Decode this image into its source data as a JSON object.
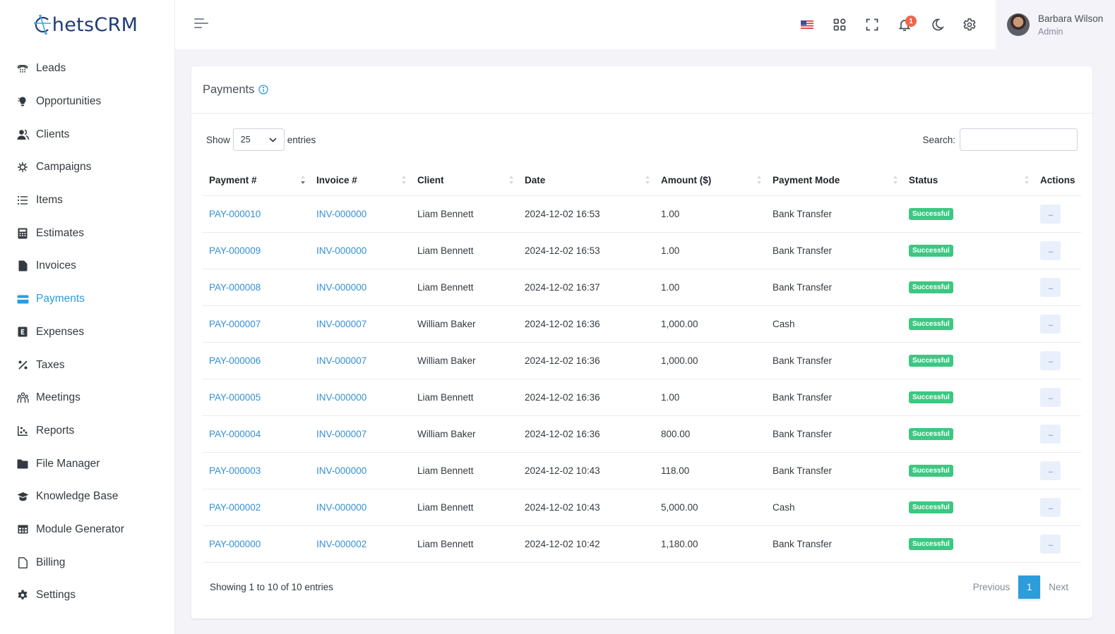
{
  "brand": {
    "name": "hetsCRM",
    "logo_letter": "C"
  },
  "sidebar": {
    "items": [
      {
        "label": "Leads",
        "icon": "phone-icon"
      },
      {
        "label": "Opportunities",
        "icon": "lightbulb-icon"
      },
      {
        "label": "Clients",
        "icon": "users-icon"
      },
      {
        "label": "Campaigns",
        "icon": "virus-icon"
      },
      {
        "label": "Items",
        "icon": "list-icon"
      },
      {
        "label": "Estimates",
        "icon": "calculator-icon"
      },
      {
        "label": "Invoices",
        "icon": "file-icon"
      },
      {
        "label": "Payments",
        "icon": "credit-card-icon",
        "active": true
      },
      {
        "label": "Expenses",
        "icon": "expense-icon"
      },
      {
        "label": "Taxes",
        "icon": "percent-icon"
      },
      {
        "label": "Meetings",
        "icon": "people-group-icon"
      },
      {
        "label": "Reports",
        "icon": "chart-scatter-icon"
      },
      {
        "label": "File Manager",
        "icon": "folder-icon"
      },
      {
        "label": "Knowledge Base",
        "icon": "graduation-cap-icon"
      },
      {
        "label": "Module Generator",
        "icon": "table-icon"
      },
      {
        "label": "Billing",
        "icon": "file-outline-icon"
      },
      {
        "label": "Settings",
        "icon": "gear-icon"
      }
    ]
  },
  "topbar": {
    "notification_count": "1",
    "user": {
      "name": "Barbara Wilson",
      "role": "Admin"
    }
  },
  "page": {
    "title": "Payments",
    "show_label": "Show",
    "entries_label": "entries",
    "page_length": "25",
    "search_label": "Search:",
    "search_value": "",
    "columns": [
      "Payment #",
      "Invoice #",
      "Client",
      "Date",
      "Amount ($)",
      "Payment Mode",
      "Status",
      "Actions"
    ],
    "rows": [
      {
        "payment": "PAY-000010",
        "invoice": "INV-000000",
        "client": "Liam Bennett",
        "date": "2024-12-02 16:53",
        "amount": "1.00",
        "mode": "Bank Transfer",
        "status": "Successful",
        "action": "..."
      },
      {
        "payment": "PAY-000009",
        "invoice": "INV-000000",
        "client": "Liam Bennett",
        "date": "2024-12-02 16:53",
        "amount": "1.00",
        "mode": "Bank Transfer",
        "status": "Successful",
        "action": "..."
      },
      {
        "payment": "PAY-000008",
        "invoice": "INV-000000",
        "client": "Liam Bennett",
        "date": "2024-12-02 16:37",
        "amount": "1.00",
        "mode": "Bank Transfer",
        "status": "Successful",
        "action": "..."
      },
      {
        "payment": "PAY-000007",
        "invoice": "INV-000007",
        "client": "William Baker",
        "date": "2024-12-02 16:36",
        "amount": "1,000.00",
        "mode": "Cash",
        "status": "Successful",
        "action": "..."
      },
      {
        "payment": "PAY-000006",
        "invoice": "INV-000007",
        "client": "William Baker",
        "date": "2024-12-02 16:36",
        "amount": "1,000.00",
        "mode": "Bank Transfer",
        "status": "Successful",
        "action": "..."
      },
      {
        "payment": "PAY-000005",
        "invoice": "INV-000000",
        "client": "Liam Bennett",
        "date": "2024-12-02 16:36",
        "amount": "1.00",
        "mode": "Bank Transfer",
        "status": "Successful",
        "action": "..."
      },
      {
        "payment": "PAY-000004",
        "invoice": "INV-000007",
        "client": "William Baker",
        "date": "2024-12-02 16:36",
        "amount": "800.00",
        "mode": "Bank Transfer",
        "status": "Successful",
        "action": "..."
      },
      {
        "payment": "PAY-000003",
        "invoice": "INV-000000",
        "client": "Liam Bennett",
        "date": "2024-12-02 10:43",
        "amount": "118.00",
        "mode": "Bank Transfer",
        "status": "Successful",
        "action": "..."
      },
      {
        "payment": "PAY-000002",
        "invoice": "INV-000000",
        "client": "Liam Bennett",
        "date": "2024-12-02 10:43",
        "amount": "5,000.00",
        "mode": "Cash",
        "status": "Successful",
        "action": "..."
      },
      {
        "payment": "PAY-000000",
        "invoice": "INV-000002",
        "client": "Liam Bennett",
        "date": "2024-12-02 10:42",
        "amount": "1,180.00",
        "mode": "Bank Transfer",
        "status": "Successful",
        "action": "..."
      }
    ],
    "showing_text": "Showing 1 to 10 of 10 entries",
    "pagination": {
      "previous": "Previous",
      "current": "1",
      "next": "Next"
    }
  },
  "colors": {
    "accent": "#2d9cdb",
    "success": "#3cc882",
    "link": "#3590d3",
    "danger_badge": "#f06548"
  }
}
